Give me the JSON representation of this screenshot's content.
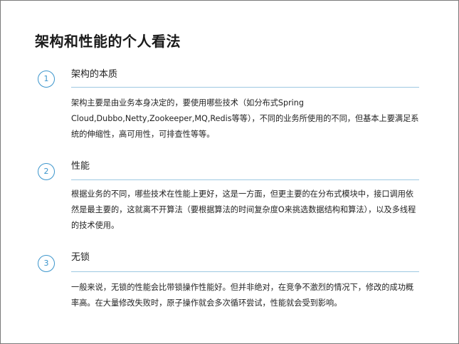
{
  "page": {
    "title": "架构和性能的个人看法"
  },
  "sections": [
    {
      "number": "1",
      "heading": "架构的本质",
      "body": "架构主要是由业务本身决定的，要使用哪些技术（如分布式Spring Cloud,Dubbo,Netty,Zookeeper,MQ,Redis等等），不同的业务所使用的不同，但基本上要满足系统的伸缩性，高可用性，可排查性等等。"
    },
    {
      "number": "2",
      "heading": "性能",
      "body": "根据业务的不同，哪些技术在性能上更好，这是一方面，但更主要的在分布式模块中，接口调用依然是最主要的，这就离不开算法（要根据算法的时间复杂度O来挑选数据结构和算法），以及多线程的技术使用。"
    },
    {
      "number": "3",
      "heading": "无锁",
      "body": "一般来说，无锁的性能会比带锁操作性能好。但并非绝对，在竞争不激烈的情况下，修改的成功概率高。在大量修改失败时，原子操作就会多次循环尝试，性能就会受到影响。"
    }
  ],
  "colors": {
    "accent": "#3b95cc",
    "rule": "#9dc8e2",
    "border": "#7a7a7a"
  }
}
